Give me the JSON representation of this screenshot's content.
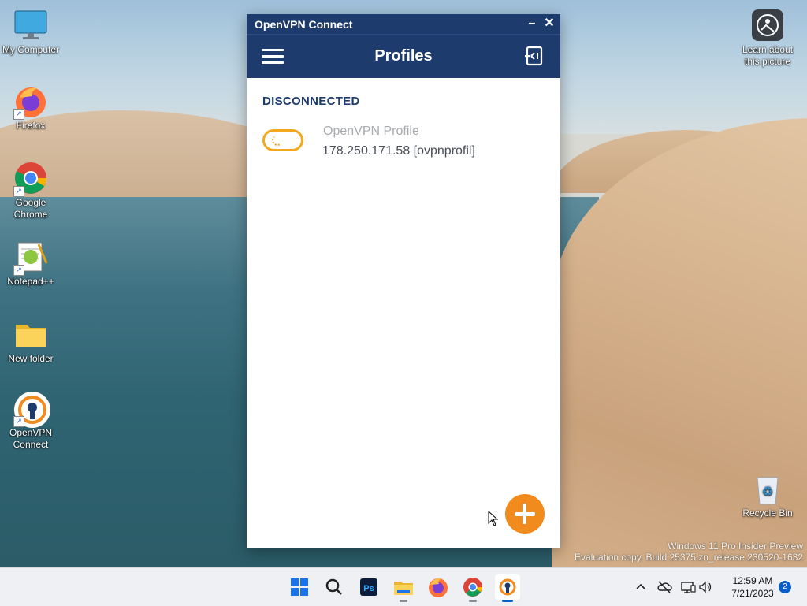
{
  "desktop": {
    "icons": [
      {
        "label": "My Computer"
      },
      {
        "label": "Firefox"
      },
      {
        "label": "Google Chrome"
      },
      {
        "label": "Notepad++"
      },
      {
        "label": "New folder"
      },
      {
        "label": "OpenVPN Connect"
      },
      {
        "label": "Learn about this picture"
      },
      {
        "label": "Recycle Bin"
      }
    ],
    "watermark": {
      "line1": "Windows 11 Pro Insider Preview",
      "line2": "Evaluation copy. Build 25375.zn_release.230520-1632"
    }
  },
  "window": {
    "title": "OpenVPN Connect",
    "minimize": "–",
    "close": "✕",
    "header_title": "Profiles",
    "status": "DISCONNECTED",
    "profile": {
      "name": "OpenVPN Profile",
      "host": "178.250.171.58 [ovpnprofil]"
    }
  },
  "taskbar": {
    "apps": [
      "start-icon",
      "search-icon",
      "photoshop-icon",
      "file-explorer-icon",
      "firefox-icon",
      "chrome-icon",
      "openvpn-icon"
    ],
    "tray": {
      "time": "12:59 AM",
      "date": "7/21/2023",
      "notifications": "2"
    }
  },
  "colors": {
    "brand_navy": "#1d3b6d",
    "toggle_orange": "#f4a81d",
    "fab_orange": "#f28b1e"
  }
}
